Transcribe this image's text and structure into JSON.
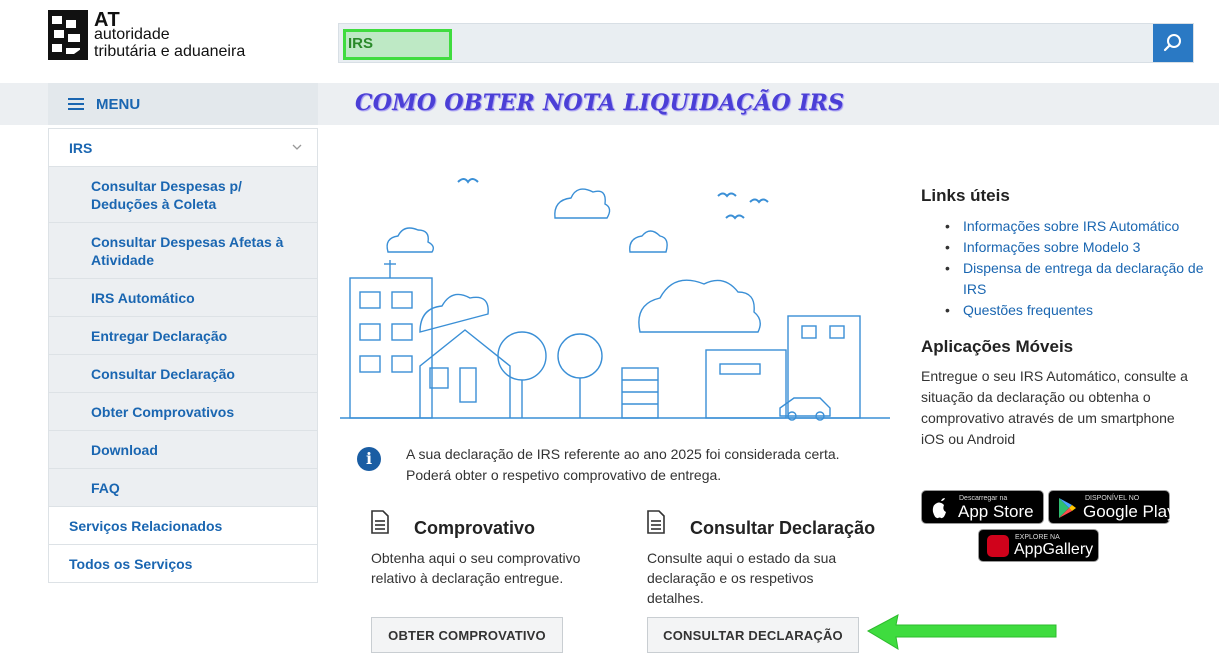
{
  "header": {
    "logo_at": "AT",
    "logo_line1": "autoridade",
    "logo_line2": "tributária e aduaneira",
    "search_typed": "IRS"
  },
  "menu": {
    "label": "MENU"
  },
  "page_title": "COMO OBTER NOTA LIQUIDAÇÃO IRS",
  "sidebar": {
    "items": [
      {
        "label": "IRS",
        "level": "top"
      },
      {
        "label": "Consultar Despesas p/ Deduções à Coleta",
        "level": "sub"
      },
      {
        "label": "Consultar Despesas Afetas à Atividade",
        "level": "sub"
      },
      {
        "label": "IRS Automático",
        "level": "sub"
      },
      {
        "label": "Entregar Declaração",
        "level": "sub"
      },
      {
        "label": "Consultar Declaração",
        "level": "sub"
      },
      {
        "label": "Obter Comprovativos",
        "level": "sub"
      },
      {
        "label": "Download",
        "level": "sub"
      },
      {
        "label": "FAQ",
        "level": "sub"
      },
      {
        "label": "Serviços Relacionados",
        "level": "top"
      },
      {
        "label": "Todos os Serviços",
        "level": "top"
      }
    ]
  },
  "info": {
    "line1": "A sua declaração de IRS referente ao ano 2025 foi considerada certa.",
    "line2": "Poderá obter o respetivo comprovativo de entrega."
  },
  "comprovativo": {
    "title": "Comprovativo",
    "desc_line1": "Obtenha aqui o seu comprovativo",
    "desc_line2": "relativo à declaração entregue.",
    "button": "OBTER COMPROVATIVO"
  },
  "consultar": {
    "title": "Consultar Declaração",
    "desc_line1": "Consulte aqui o estado da sua",
    "desc_line2": "declaração e os respetivos",
    "desc_line3": "detalhes.",
    "button": "CONSULTAR DECLARAÇÃO"
  },
  "links_uteis": {
    "title": "Links úteis",
    "items": [
      "Informações sobre IRS Automático",
      "Informações sobre Modelo 3",
      "Dispensa de entrega da declaração de IRS",
      "Questões frequentes"
    ]
  },
  "apps": {
    "title": "Aplicações Móveis",
    "desc": "Entregue o seu IRS Automático, consulte a situação da declaração ou obtenha o comprovativo através de um smartphone iOS ou Android",
    "app_store_small": "Descarregar na",
    "app_store_big": "App Store",
    "google_play_small": "DISPONÍVEL NO",
    "google_play_big": "Google Play",
    "app_gallery_small": "EXPLORE NA",
    "app_gallery_big": "AppGallery"
  },
  "colors": {
    "link_blue": "#1a66b1",
    "search_button": "#2a79c4",
    "title_purple": "#4b3fd6",
    "highlight_green": "#3fdc3f",
    "sidebar_sub_bg": "#eceff2"
  }
}
